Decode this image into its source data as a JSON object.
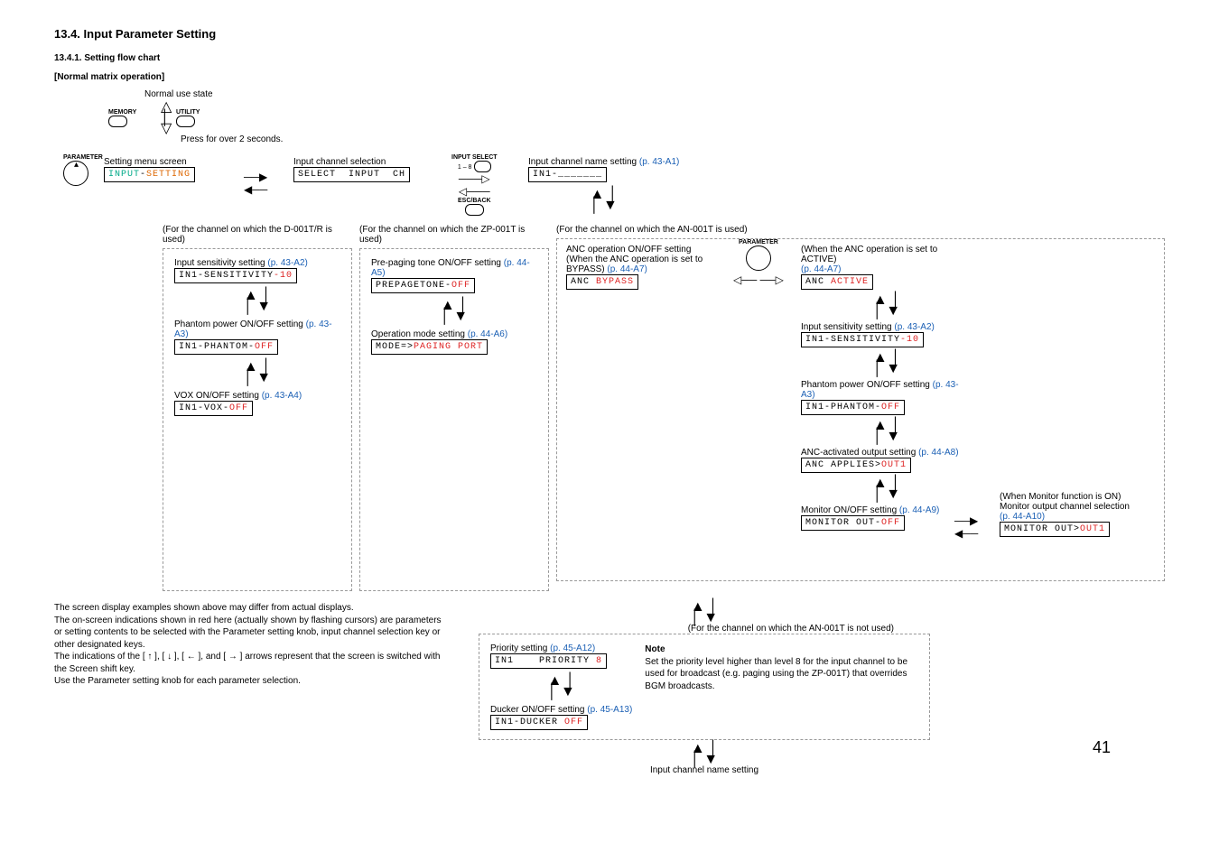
{
  "headings": {
    "h2": "13.4. Input Parameter Setting",
    "h3": "13.4.1. Setting flow chart",
    "h4": "[Normal matrix operation]"
  },
  "top": {
    "normal_use_state": "Normal use state",
    "memory": "MEMORY",
    "utility": "UTILITY",
    "press_note": "Press for over 2 seconds.",
    "parameter": "PARAMETER",
    "setting_menu": "Setting menu screen",
    "lcd_input_setting_1": "INPUT",
    "lcd_input_setting_dash": "-",
    "lcd_input_setting_2": "SETTING",
    "input_ch_sel": "Input channel selection",
    "lcd_select_input": "SELECT  INPUT  CH",
    "input_select": "INPUT SELECT",
    "input_select_range": "1 – 8",
    "esc_back": "ESC/BACK",
    "ch_name_setting": "Input channel name setting",
    "ch_name_ref": "(p. 43-A1)",
    "lcd_in1_name": "IN1-_______"
  },
  "group_d": {
    "title": "(For the channel on which the D-001T/R is used)",
    "sens_label": "Input sensitivity setting",
    "sens_ref": "(p. 43-A2)",
    "sens_lcd_a": "IN1-SENSITIVITY",
    "sens_lcd_b": "-10",
    "phantom_label": "Phantom power ON/OFF setting",
    "phantom_ref": "(p. 43-A3)",
    "phantom_lcd_a": "IN1-PHANTOM-",
    "phantom_lcd_b": "OFF",
    "vox_label": "VOX ON/OFF setting",
    "vox_ref": "(p. 43-A4)",
    "vox_lcd_a": "IN1-VOX-",
    "vox_lcd_b": "OFF"
  },
  "group_zp": {
    "title": "(For the channel on which the ZP-001T is used)",
    "prepage_label": "Pre-paging tone ON/OFF setting",
    "prepage_ref": "(p. 44-A5)",
    "prepage_lcd_a": "PREPAGETONE-",
    "prepage_lcd_b": "OFF",
    "mode_label": "Operation mode setting",
    "mode_ref": "(p. 44-A6)",
    "mode_lcd_a": "MODE=>",
    "mode_lcd_b": "PAGING PORT"
  },
  "group_an": {
    "title": "(For the channel on which the AN-001T is used)",
    "anc_op_label": "ANC operation ON/OFF setting",
    "anc_op_sub": "(When the ANC operation is set to BYPASS)",
    "anc_op_ref": "(p. 44-A7)",
    "anc_bypass_lcd_a": "ANC ",
    "anc_bypass_lcd_b": "BYPASS",
    "anc_active_note": "(When the ANC operation is set to ACTIVE)",
    "anc_active_ref": "(p. 44-A7)",
    "anc_active_lcd_a": "ANC ",
    "anc_active_lcd_b": "ACTIVE",
    "parameter": "PARAMETER",
    "sens_label": "Input sensitivity setting",
    "sens_ref": "(p. 43-A2)",
    "sens_lcd_a": "IN1-SENSITIVITY",
    "sens_lcd_b": "-10",
    "phantom_label": "Phantom power ON/OFF setting",
    "phantom_ref": "(p. 43-A3)",
    "phantom_lcd_a": "IN1-PHANTOM-",
    "phantom_lcd_b": "OFF",
    "anc_out_label": "ANC-activated output setting",
    "anc_out_ref": "(p. 44-A8)",
    "anc_out_lcd_a": "ANC APPLIES>",
    "anc_out_lcd_b": "OUT1",
    "mon_label": "Monitor ON/OFF setting",
    "mon_ref": "(p. 44-A9)",
    "mon_lcd_a": "MONITOR OUT-",
    "mon_lcd_b": "OFF",
    "mon_sel_note1": "(When Monitor function is ON)",
    "mon_sel_note2": "Monitor output channel selection",
    "mon_sel_ref": "(p. 44-A10)",
    "mon_sel_lcd_a": "MONITOR OUT>",
    "mon_sel_lcd_b": "OUT1"
  },
  "group_notan": {
    "title": "(For the channel on which the AN-001T is not used)",
    "prio_label": "Priority setting",
    "prio_ref": "(p. 45-A12)",
    "prio_lcd_a": "IN1    PRIORITY ",
    "prio_lcd_b": "8",
    "note_title": "Note",
    "note_body": "Set the priority level higher than level 8 for the input channel to be used for broadcast (e.g. paging using the ZP-001T) that overrides BGM broadcasts.",
    "ducker_label": "Ducker ON/OFF setting",
    "ducker_ref": "(p. 45-A13)",
    "ducker_lcd_a": "IN1-DUCKER ",
    "ducker_lcd_b": "OFF",
    "bottom_label": "Input channel name setting"
  },
  "footer_note": {
    "l1": "The screen display examples shown above may differ from actual displays.",
    "l2": "The on-screen indications shown in red here (actually shown by flashing cursors) are parameters or setting contents to be selected with the Parameter setting knob, input channel selection key or other designated keys.",
    "l3": "The indications of the [ ↑ ], [ ↓ ], [ ← ], and [ → ] arrows represent that the screen is switched with the Screen shift key.",
    "l4": "Use the Parameter setting knob for each parameter selection."
  },
  "page_number": "41"
}
